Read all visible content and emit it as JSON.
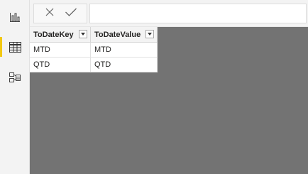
{
  "rail": {
    "items": [
      {
        "icon": "report-view-icon",
        "active": false
      },
      {
        "icon": "data-view-icon",
        "active": true
      },
      {
        "icon": "model-view-icon",
        "active": false
      }
    ],
    "accent": "#f2c811"
  },
  "formula_bar": {
    "cancel_icon": "close-icon",
    "commit_icon": "check-icon",
    "value": ""
  },
  "table": {
    "columns": [
      {
        "label": "ToDateKey",
        "filter_icon": "chevron-down-icon"
      },
      {
        "label": "ToDateValue",
        "filter_icon": "chevron-down-icon"
      }
    ],
    "rows": [
      [
        "MTD",
        "MTD"
      ],
      [
        "QTD",
        "QTD"
      ]
    ]
  },
  "colors": {
    "canvas_bg": "#737373",
    "rail_bg": "#f3f3f3",
    "accent": "#f2c811"
  }
}
